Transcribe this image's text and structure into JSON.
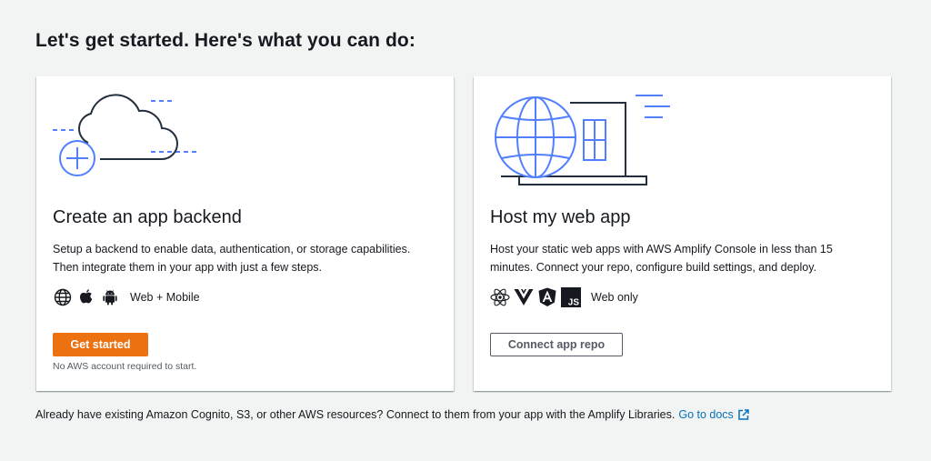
{
  "page": {
    "title": "Let's get started. Here's what you can do:"
  },
  "backend_card": {
    "title": "Create an app backend",
    "description": "Setup a backend to enable data, authentication, or storage capabilities. Then integrate them in your app with just a few steps.",
    "platform_icons": [
      "globe-icon",
      "apple-icon",
      "android-icon"
    ],
    "platform_label": "Web + Mobile",
    "button_label": "Get started",
    "hint": "No AWS account required to start."
  },
  "hosting_card": {
    "title": "Host my web app",
    "description": "Host your static web apps with AWS Amplify Console in less than 15 minutes. Connect your repo, configure build settings, and deploy.",
    "platform_icons": [
      "react-icon",
      "vue-icon",
      "angular-icon",
      "javascript-icon"
    ],
    "platform_label": "Web only",
    "button_label": "Connect app repo"
  },
  "footer": {
    "text": "Already have existing Amazon Cognito, S3, or other AWS resources? Connect to them from your app with the Amplify Libraries.",
    "link_label": "Go to docs",
    "link_icon": "external-link-icon"
  },
  "colors": {
    "background": "#f2f3f3",
    "primary_button": "#ec7211",
    "link": "#0073bb",
    "illustration_accent": "#527fff",
    "text": "#16191f"
  }
}
